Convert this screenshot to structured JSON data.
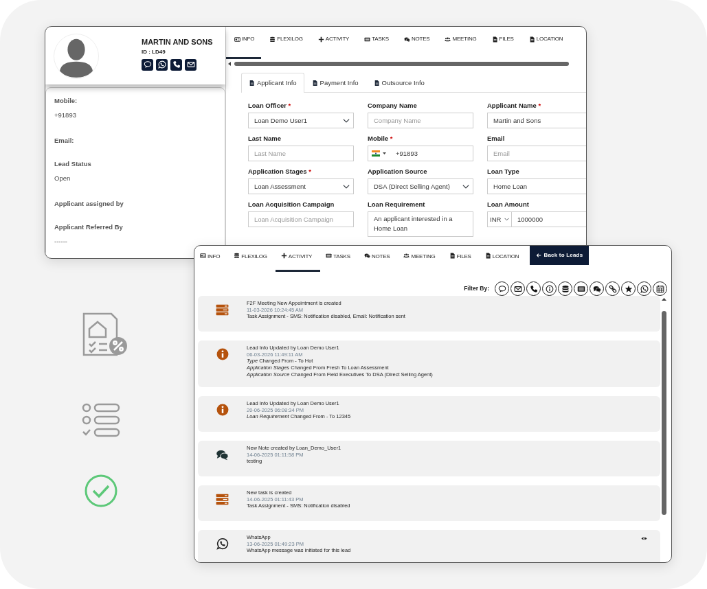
{
  "profile": {
    "name": "MARTIN AND SONS",
    "id": "ID : LD49",
    "details": [
      {
        "label": "Mobile:",
        "value": "+91893"
      },
      {
        "label": "Email:"
      },
      {
        "label": "Lead Status",
        "value": "Open"
      },
      {
        "label": "Applicant assigned by"
      },
      {
        "label": "Applicant Referred By",
        "value": "------"
      }
    ]
  },
  "info_tabs": [
    {
      "label": "INFO",
      "selected": true
    },
    {
      "label": "FLEXILOG",
      "selected": false
    },
    {
      "label": "ACTIVITY",
      "selected": false
    },
    {
      "label": "TASKS",
      "selected": false
    },
    {
      "label": "NOTES",
      "selected": false
    },
    {
      "label": "MEETING",
      "selected": false
    },
    {
      "label": "FILES",
      "selected": false
    },
    {
      "label": "LOCATION",
      "selected": false
    }
  ],
  "form_tabs": [
    {
      "label": "Applicant Info",
      "selected": true
    },
    {
      "label": "Payment Info",
      "selected": false
    },
    {
      "label": "Outsource Info",
      "selected": false
    }
  ],
  "form_fields": [
    {
      "label": "Loan Officer",
      "marker": "*",
      "kind": "select",
      "value": "Loan Demo User1"
    },
    {
      "label": "Company Name",
      "kind": "input",
      "placeholder": "Company Name"
    },
    {
      "label": "Applicant Name",
      "marker": "*",
      "kind": "input",
      "value": "Martin and Sons"
    },
    {
      "label": "Last Name",
      "kind": "input",
      "placeholder": "Last Name"
    },
    {
      "label": "Mobile",
      "marker": "*",
      "kind": "phone",
      "value": "+91893"
    },
    {
      "label": "Email",
      "kind": "input",
      "placeholder": "Email"
    },
    {
      "label": "Application Stages",
      "marker": "*",
      "kind": "select",
      "value": "Loan Assessment"
    },
    {
      "label": "Application Source",
      "kind": "select",
      "value": "DSA (Direct Selling Agent)"
    },
    {
      "label": "Loan Type",
      "kind": "input",
      "value": "Home Loan"
    },
    {
      "label": "Loan Acquisition Campaign",
      "kind": "input",
      "placeholder": "Loan Acquisition Campaign"
    },
    {
      "label": "Loan Requirement",
      "kind": "textarea",
      "value": "An applicant interested in a Home Loan"
    },
    {
      "label": "Loan Amount",
      "kind": "currency",
      "currency": "INR",
      "value": "1000000"
    }
  ],
  "activity": {
    "tabs": [
      {
        "label": "INFO",
        "selected": false
      },
      {
        "label": "FLEXILOG",
        "selected": false
      },
      {
        "label": "ACTIVITY",
        "selected": true
      },
      {
        "label": "TASKS",
        "selected": false
      },
      {
        "label": "NOTES",
        "selected": false
      },
      {
        "label": "MEETING",
        "selected": false
      },
      {
        "label": "FILES",
        "selected": false
      },
      {
        "label": "LOCATION",
        "selected": false
      }
    ],
    "back_button": "Back to Leads",
    "filter_label": "Filter By:",
    "entries": [
      {
        "kind": "task",
        "title": "F2F Meeting New Appointment is created",
        "time": "11-03-2026 10:24:45 AM",
        "lines": [
          "Task Assignment - SMS: Notification disabled, Email: Notification sent"
        ]
      },
      {
        "kind": "info",
        "title": "Lead Info Updated by Loan Demo User1",
        "time": "06-03-2026 11:49:11 AM",
        "lines": [
          "*Type* Changed From - To Hot",
          "*Application Stages* Changed From Fresh To Loan Assessment",
          "*Application Source* Changed From Field Executives To DSA (Direct Selling Agent)"
        ]
      },
      {
        "kind": "info",
        "title": "Lead Info Updated by Loan Demo User1",
        "time": "20-06-2025 06:08:34 PM",
        "lines": [
          "*Loan Requirement* Changed From - To 12345"
        ]
      },
      {
        "kind": "note",
        "title": "New Note created by Loan_Demo_User1",
        "time": "14-06-2025 01:11:58 PM",
        "lines": [
          "testing"
        ]
      },
      {
        "kind": "task",
        "title": "New task is created",
        "time": "14-06-2025 01:11:43 PM",
        "lines": [
          "Task Assignment - SMS: Notification disabled"
        ]
      },
      {
        "kind": "whatsapp",
        "title": "WhatsApp",
        "time": "13-06-2025 01:49:23 PM",
        "lines": [
          "WhatsApp message was initiated for this lead"
        ]
      }
    ]
  }
}
